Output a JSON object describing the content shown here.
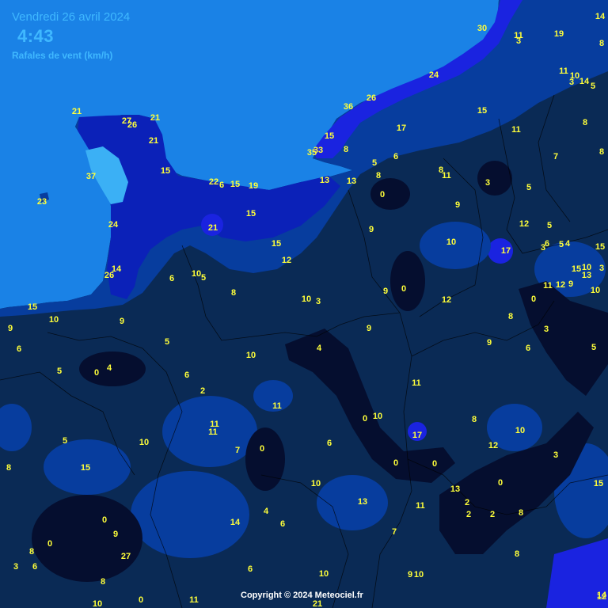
{
  "header": {
    "date": "Vendredi 26 avril 2024",
    "time": "4:43",
    "subtitle": "Rafales de vent (km/h)"
  },
  "copyright": "Copyright © 2024 Meteociel.fr",
  "colors": {
    "sea": "#1a82e6",
    "land_calm": "#0a2a55",
    "land_very_calm": "#050e2f",
    "light_band": "#073d9e",
    "mid_band": "#0b21b8",
    "strong_band": "#1a23e0",
    "strongest_band": "#3bb0f5",
    "labels": "#ffff3a"
  },
  "wind_gusts_kmh": [
    {
      "v": "30"
    },
    {
      "v": "14"
    },
    {
      "v": "11"
    },
    {
      "v": "3"
    },
    {
      "v": "19"
    },
    {
      "v": "8"
    },
    {
      "v": "24"
    },
    {
      "v": "11"
    },
    {
      "v": "10"
    },
    {
      "v": "3"
    },
    {
      "v": "14"
    },
    {
      "v": "5"
    },
    {
      "v": "36"
    },
    {
      "v": "26"
    },
    {
      "v": "15"
    },
    {
      "v": "8"
    },
    {
      "v": "21"
    },
    {
      "v": "27"
    },
    {
      "v": "26"
    },
    {
      "v": "21"
    },
    {
      "v": "21"
    },
    {
      "v": "17"
    },
    {
      "v": "11"
    },
    {
      "v": "15"
    },
    {
      "v": "35"
    },
    {
      "v": "33"
    },
    {
      "v": "8"
    },
    {
      "v": "6"
    },
    {
      "v": "7"
    },
    {
      "v": "8"
    },
    {
      "v": "37"
    },
    {
      "v": "15"
    },
    {
      "v": "5"
    },
    {
      "v": "8"
    },
    {
      "v": "8"
    },
    {
      "v": "11"
    },
    {
      "v": "22"
    },
    {
      "v": "6"
    },
    {
      "v": "15"
    },
    {
      "v": "19"
    },
    {
      "v": "13"
    },
    {
      "v": "13"
    },
    {
      "v": "3"
    },
    {
      "v": "5"
    },
    {
      "v": "23"
    },
    {
      "v": "0"
    },
    {
      "v": "9"
    },
    {
      "v": "15"
    },
    {
      "v": "24"
    },
    {
      "v": "21"
    },
    {
      "v": "12"
    },
    {
      "v": "5"
    },
    {
      "v": "9"
    },
    {
      "v": "6"
    },
    {
      "v": "5"
    },
    {
      "v": "4"
    },
    {
      "v": "15"
    },
    {
      "v": "15"
    },
    {
      "v": "10"
    },
    {
      "v": "17"
    },
    {
      "v": "3"
    },
    {
      "v": "3"
    },
    {
      "v": "12"
    },
    {
      "v": "15"
    },
    {
      "v": "10"
    },
    {
      "v": "13"
    },
    {
      "v": "14"
    },
    {
      "v": "26"
    },
    {
      "v": "6"
    },
    {
      "v": "10"
    },
    {
      "v": "5"
    },
    {
      "v": "0"
    },
    {
      "v": "11"
    },
    {
      "v": "12"
    },
    {
      "v": "9"
    },
    {
      "v": "10"
    },
    {
      "v": "8"
    },
    {
      "v": "10"
    },
    {
      "v": "3"
    },
    {
      "v": "9"
    },
    {
      "v": "12"
    },
    {
      "v": "0"
    },
    {
      "v": "15"
    },
    {
      "v": "10"
    },
    {
      "v": "9"
    },
    {
      "v": "8"
    },
    {
      "v": "3"
    },
    {
      "v": "9"
    },
    {
      "v": "6"
    },
    {
      "v": "5"
    },
    {
      "v": "9"
    },
    {
      "v": "6"
    },
    {
      "v": "4"
    },
    {
      "v": "4"
    },
    {
      "v": "5"
    },
    {
      "v": "0"
    },
    {
      "v": "5"
    },
    {
      "v": "6"
    },
    {
      "v": "2"
    },
    {
      "v": "10"
    },
    {
      "v": "9"
    },
    {
      "v": "11"
    },
    {
      "v": "11"
    },
    {
      "v": "11"
    },
    {
      "v": "11"
    },
    {
      "v": "0"
    },
    {
      "v": "10"
    },
    {
      "v": "8"
    },
    {
      "v": "10"
    },
    {
      "v": "5"
    },
    {
      "v": "10"
    },
    {
      "v": "17"
    },
    {
      "v": "12"
    },
    {
      "v": "6"
    },
    {
      "v": "7"
    },
    {
      "v": "0"
    },
    {
      "v": "3"
    },
    {
      "v": "8"
    },
    {
      "v": "15"
    },
    {
      "v": "0"
    },
    {
      "v": "0"
    },
    {
      "v": "10"
    },
    {
      "v": "15"
    },
    {
      "v": "13"
    },
    {
      "v": "0"
    },
    {
      "v": "13"
    },
    {
      "v": "11"
    },
    {
      "v": "2"
    },
    {
      "v": "2"
    },
    {
      "v": "2"
    },
    {
      "v": "4"
    },
    {
      "v": "6"
    },
    {
      "v": "14"
    },
    {
      "v": "0"
    },
    {
      "v": "8"
    },
    {
      "v": "0"
    },
    {
      "v": "8"
    },
    {
      "v": "9"
    },
    {
      "v": "7"
    },
    {
      "v": "8"
    },
    {
      "v": "27"
    },
    {
      "v": "3"
    },
    {
      "v": "6"
    },
    {
      "v": "8"
    },
    {
      "v": "6"
    },
    {
      "v": "9"
    },
    {
      "v": "10"
    },
    {
      "v": "10"
    },
    {
      "v": "11"
    },
    {
      "v": "0"
    },
    {
      "v": "10"
    },
    {
      "v": "21"
    },
    {
      "v": "12"
    },
    {
      "v": "14"
    }
  ]
}
